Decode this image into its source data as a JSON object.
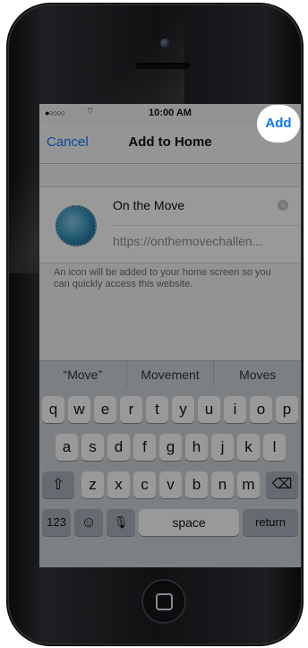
{
  "status_bar": {
    "signal": "●○○○○",
    "wifi": "⌔",
    "time": "10:00 AM"
  },
  "navbar": {
    "cancel": "Cancel",
    "title": "Add to Home",
    "add": "Add"
  },
  "bookmark": {
    "name": "On the Move",
    "url": "https://onthemovechallen...",
    "clear_glyph": "×"
  },
  "helper_text": "An icon will be added to your home screen so you can quickly access this website.",
  "predictions": [
    "“Move”",
    "Movement",
    "Moves"
  ],
  "keyboard": {
    "row1": [
      "q",
      "w",
      "e",
      "r",
      "t",
      "y",
      "u",
      "i",
      "o",
      "p"
    ],
    "row2": [
      "a",
      "s",
      "d",
      "f",
      "g",
      "h",
      "j",
      "k",
      "l"
    ],
    "row3": [
      "z",
      "x",
      "c",
      "v",
      "b",
      "n",
      "m"
    ],
    "shift": "⇧",
    "delete": "⌫",
    "numbers": "123",
    "emoji": "☺",
    "mic": "🎙",
    "space": "space",
    "return": "return"
  },
  "colors": {
    "accent": "#0a7aff"
  }
}
